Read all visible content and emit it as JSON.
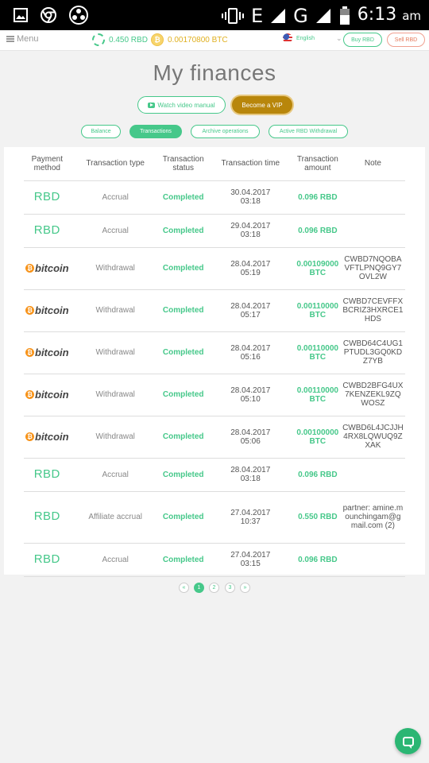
{
  "status_bar": {
    "network": "E",
    "network2": "G",
    "time": "6:13",
    "ampm": "am"
  },
  "nav": {
    "menu_label": "Menu",
    "rbd_balance": "0.450 RBD",
    "btc_balance": "0.00170800 BTC",
    "language": "English",
    "buy_label": "Buy RBD",
    "sell_label": "Sell RBD"
  },
  "page": {
    "title": "My finances",
    "video_button": "Watch video manual",
    "vip_button": "Become a VIP"
  },
  "tabs": [
    {
      "label": "Balance",
      "active": false
    },
    {
      "label": "Transactions",
      "active": true
    },
    {
      "label": "Archive operations",
      "active": false
    },
    {
      "label": "Active RBD Withdrawal",
      "active": false
    }
  ],
  "table": {
    "headers": [
      "Payment method",
      "Transaction type",
      "Transaction status",
      "Transaction time",
      "Transaction amount",
      "Note"
    ],
    "rows": [
      {
        "method": "RBD",
        "type": "Accrual",
        "status": "Completed",
        "date": "30.04.2017",
        "time": "03:18",
        "amount": "0.096 RBD",
        "unit": "",
        "note": ""
      },
      {
        "method": "RBD",
        "type": "Accrual",
        "status": "Completed",
        "date": "29.04.2017",
        "time": "03:18",
        "amount": "0.096 RBD",
        "unit": "",
        "note": ""
      },
      {
        "method": "bitcoin",
        "type": "Withdrawal",
        "status": "Completed",
        "date": "28.04.2017",
        "time": "05:19",
        "amount": "0.00109000",
        "unit": "BTC",
        "note": "CWBD7NQOBAVFTLPNQ9GY7OVL2W"
      },
      {
        "method": "bitcoin",
        "type": "Withdrawal",
        "status": "Completed",
        "date": "28.04.2017",
        "time": "05:17",
        "amount": "0.00110000",
        "unit": "BTC",
        "note": "CWBD7CEVFFXBCRIZ3HXRCE1HDS"
      },
      {
        "method": "bitcoin",
        "type": "Withdrawal",
        "status": "Completed",
        "date": "28.04.2017",
        "time": "05:16",
        "amount": "0.00110000",
        "unit": "BTC",
        "note": "CWBD64C4UG1PTUDL3GQ0KDZ7YB"
      },
      {
        "method": "bitcoin",
        "type": "Withdrawal",
        "status": "Completed",
        "date": "28.04.2017",
        "time": "05:10",
        "amount": "0.00110000",
        "unit": "BTC",
        "note": "CWBD2BFG4UX7KENZEKL9ZQWOSZ"
      },
      {
        "method": "bitcoin",
        "type": "Withdrawal",
        "status": "Completed",
        "date": "28.04.2017",
        "time": "05:06",
        "amount": "0.00100000",
        "unit": "BTC",
        "note": "CWBD6L4JCJJH4RX8LQWUQ9ZXAK"
      },
      {
        "method": "RBD",
        "type": "Accrual",
        "status": "Completed",
        "date": "28.04.2017",
        "time": "03:18",
        "amount": "0.096 RBD",
        "unit": "",
        "note": ""
      },
      {
        "method": "RBD",
        "type": "Affiliate accrual",
        "status": "Completed",
        "date": "27.04.2017",
        "time": "10:37",
        "amount": "0.550 RBD",
        "unit": "",
        "note": "partner: amine.mounchingam@gmail.com (2)"
      },
      {
        "method": "RBD",
        "type": "Accrual",
        "status": "Completed",
        "date": "27.04.2017",
        "time": "03:15",
        "amount": "0.096 RBD",
        "unit": "",
        "note": ""
      }
    ]
  },
  "pagination": {
    "prev": "«",
    "pages": [
      "1",
      "2",
      "3"
    ],
    "current": "1",
    "next": "»"
  },
  "colors": {
    "accent": "#46c88a",
    "vip": "#b8860b",
    "sell": "#e57a5c",
    "bitcoin": "#f7931a"
  }
}
